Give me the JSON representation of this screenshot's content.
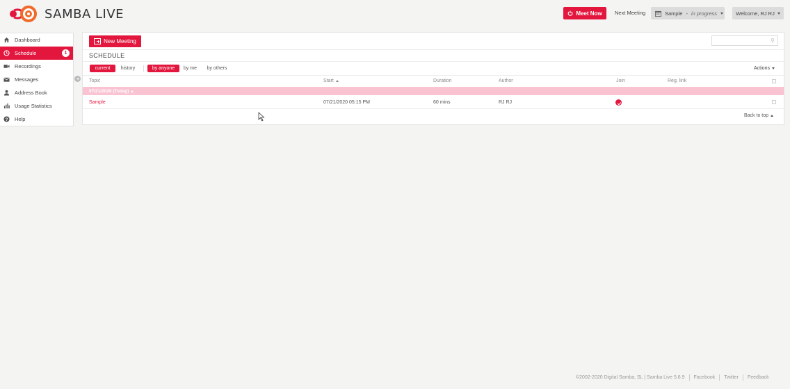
{
  "header": {
    "brand": "SAMBA LIVE",
    "meet_now": "Meet Now",
    "next_meeting_label": "Next Meeting",
    "next_meeting_name": "Sample",
    "next_meeting_status": "in progress",
    "next_meeting_separator": "-",
    "welcome": "Welcome, RJ RJ"
  },
  "sidebar": {
    "items": [
      {
        "label": "Dashboard",
        "icon": "home-icon"
      },
      {
        "label": "Schedule",
        "icon": "clock-icon",
        "badge": "1",
        "active": true
      },
      {
        "label": "Recordings",
        "icon": "video-icon"
      },
      {
        "label": "Messages",
        "icon": "envelope-icon"
      },
      {
        "label": "Address Book",
        "icon": "user-icon"
      },
      {
        "label": "Usage Statistics",
        "icon": "bar-chart-icon"
      },
      {
        "label": "Help",
        "icon": "question-icon"
      }
    ]
  },
  "main": {
    "new_meeting": "New Meeting",
    "search_placeholder": "",
    "title": "SCHEDULE",
    "filters": {
      "current": "current",
      "history": "history",
      "by_anyone": "by anyone",
      "by_me": "by me",
      "by_others": "by others"
    },
    "actions": "Actions",
    "columns": {
      "topic": "Topic",
      "start": "Start",
      "duration": "Duration",
      "author": "Author",
      "join": "Join",
      "reg_link": "Reg. link"
    },
    "group": "07/21/2020 (Today)",
    "rows": [
      {
        "topic": "Sample",
        "start": "07/21/2020 05:15 PM",
        "duration": "60 mins",
        "author": "RJ RJ"
      }
    ],
    "back_to_top": "Back to top"
  },
  "footer": {
    "copyright": "©2002-2020 Digital Samba, SL | Samba Live 5.6.9",
    "facebook": "Facebook",
    "twitter": "Twitter",
    "feedback": "Feedback"
  },
  "colors": {
    "accent": "#e3173e",
    "group_row": "#f9c3d2"
  }
}
